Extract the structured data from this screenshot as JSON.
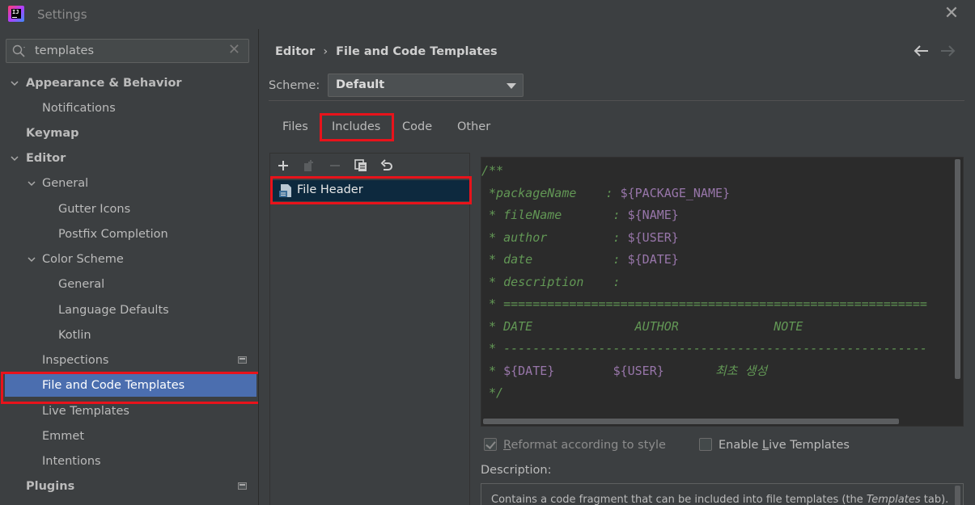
{
  "window": {
    "title": "Settings"
  },
  "search": {
    "value": "templates",
    "placeholder": ""
  },
  "sidebar": {
    "items": [
      {
        "label": "Appearance & Behavior"
      },
      {
        "label": "Notifications"
      },
      {
        "label": "Keymap"
      },
      {
        "label": "Editor"
      },
      {
        "label": "General"
      },
      {
        "label": "Gutter Icons"
      },
      {
        "label": "Postfix Completion"
      },
      {
        "label": "Color Scheme"
      },
      {
        "label": "General"
      },
      {
        "label": "Language Defaults"
      },
      {
        "label": "Kotlin"
      },
      {
        "label": "Inspections"
      },
      {
        "label": "File and Code Templates"
      },
      {
        "label": "Live Templates"
      },
      {
        "label": "Emmet"
      },
      {
        "label": "Intentions"
      },
      {
        "label": "Plugins"
      }
    ]
  },
  "breadcrumb": {
    "parent": "Editor",
    "current": "File and Code Templates"
  },
  "scheme": {
    "label": "Scheme:",
    "value": "Default"
  },
  "tabs": [
    {
      "label": "Files"
    },
    {
      "label": "Includes"
    },
    {
      "label": "Code"
    },
    {
      "label": "Other"
    }
  ],
  "templates_list": {
    "items": [
      {
        "label": "File Header"
      }
    ]
  },
  "editor": {
    "lines": [
      {
        "text": "/**"
      },
      {
        "text": " *packageName",
        "pad": "    : ",
        "var": "${PACKAGE_NAME}"
      },
      {
        "text": " * fileName",
        "pad": "       : ",
        "var": "${NAME}"
      },
      {
        "text": " * author",
        "pad": "         : ",
        "var": "${USER}"
      },
      {
        "text": " * date",
        "pad": "           : ",
        "var": "${DATE}"
      },
      {
        "text": " * description    :",
        "pad": "",
        "var": ""
      },
      {
        "text": " * ==========================================================",
        "pad": "",
        "var": ""
      },
      {
        "text": " * DATE              AUTHOR             NOTE",
        "pad": "",
        "var": ""
      },
      {
        "text": " * ----------------------------------------------------------",
        "pad": "",
        "var": ""
      },
      {
        "text": " * ",
        "pad": "",
        "var": "${DATE}",
        "mid": "        ",
        "var2": "${USER}",
        "tail": "       최초 생성"
      },
      {
        "text": " */",
        "pad": "",
        "var": ""
      }
    ]
  },
  "options": {
    "reformat": {
      "label_pre": "",
      "label_u": "R",
      "label_post": "eformat according to style",
      "checked": true
    },
    "live_templates": {
      "label_pre": "Enable ",
      "label_u": "L",
      "label_post": "ive Templates",
      "checked": false
    }
  },
  "description": {
    "label": "Description:",
    "text_pre": "Contains a code fragment that can be included into file templates (the ",
    "text_em": "Templates",
    "text_post": " tab)."
  }
}
